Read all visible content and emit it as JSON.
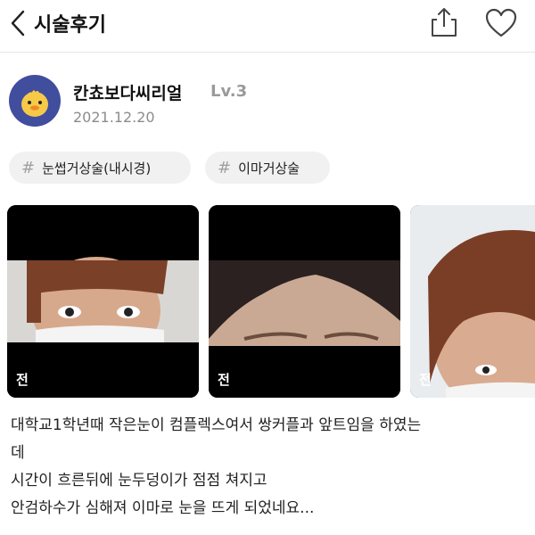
{
  "header": {
    "title": "시술후기"
  },
  "post": {
    "author": "칸쵸보다씨리얼",
    "level": "Lv.3",
    "date": "2021.12.20",
    "tags": [
      "눈썹거상술(내시경)",
      "이마거상술"
    ],
    "photos": [
      {
        "label": "전"
      },
      {
        "label": "전"
      },
      {
        "label": "전"
      }
    ],
    "body_lines": [
      "대학교1학년때 작은눈이 컴플렉스여서 쌍커플과 앞트임을 하였는",
      "데",
      "시간이 흐른뒤에 눈두덩이가 점점 쳐지고",
      "안검하수가 심해져 이마로 눈을 뜨게 되었네요..."
    ]
  },
  "icons": {
    "back": "chevron-left-icon",
    "share": "share-icon",
    "like": "heart-outline-icon",
    "hashtag": "hashtag-icon"
  },
  "colors": {
    "avatar_bg": "#404e9d",
    "duck": "#f7c948",
    "tag_bg": "#f1f1f1",
    "muted_text": "#8c8c8c"
  }
}
